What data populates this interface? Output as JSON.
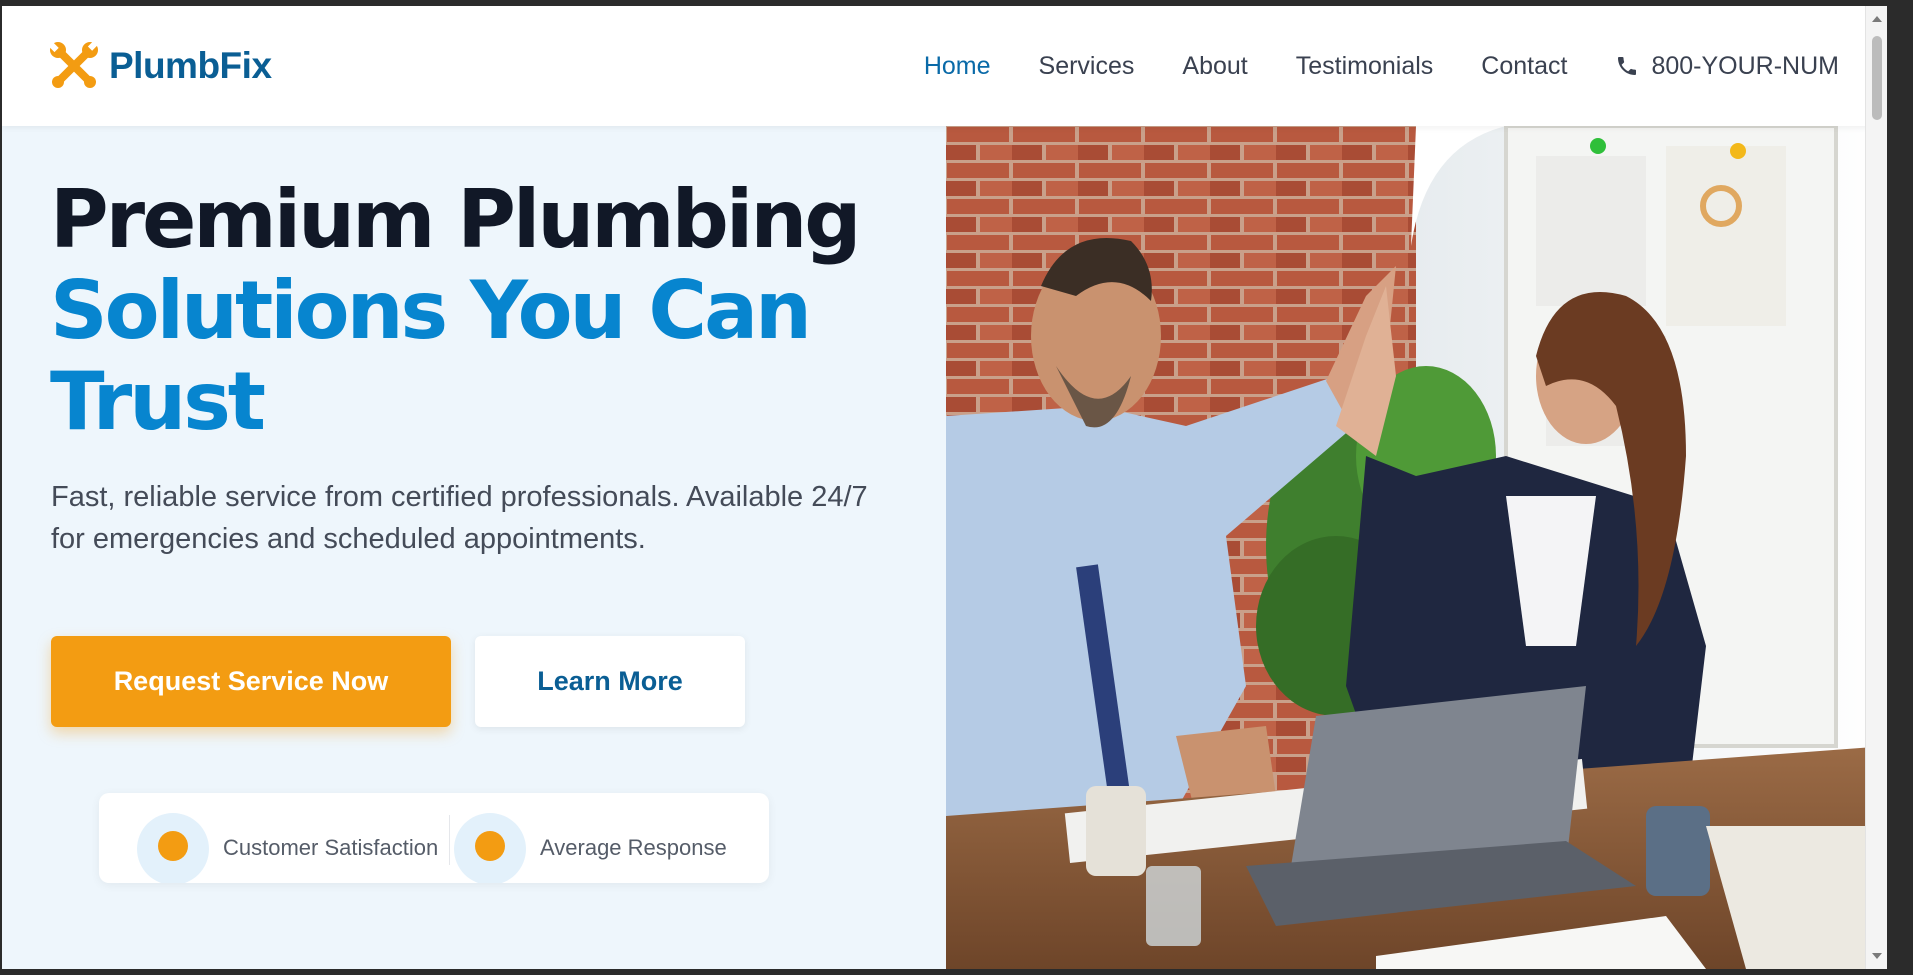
{
  "brand": {
    "name": "PlumbFix",
    "icon": "wrench-cross-icon",
    "primary_color": "#0a5e94",
    "accent_color": "#f39c12"
  },
  "nav": {
    "items": [
      {
        "label": "Home",
        "active": true
      },
      {
        "label": "Services",
        "active": false
      },
      {
        "label": "About",
        "active": false
      },
      {
        "label": "Testimonials",
        "active": false
      },
      {
        "label": "Contact",
        "active": false
      }
    ],
    "phone": {
      "icon": "phone-icon",
      "number": "800-YOUR-NUM"
    }
  },
  "hero": {
    "title_line1": "Premium Plumbing",
    "title_line2": "Solutions You Can Trust",
    "subtitle": "Fast, reliable service from certified professionals. Available 24/7 for emergencies and scheduled appointments.",
    "primary_button": "Request Service Now",
    "secondary_button": "Learn More",
    "image": "two-colleagues-high-five-office-photo"
  },
  "stats": [
    {
      "label": "Customer Satisfaction"
    },
    {
      "label": "Average Response"
    }
  ]
}
